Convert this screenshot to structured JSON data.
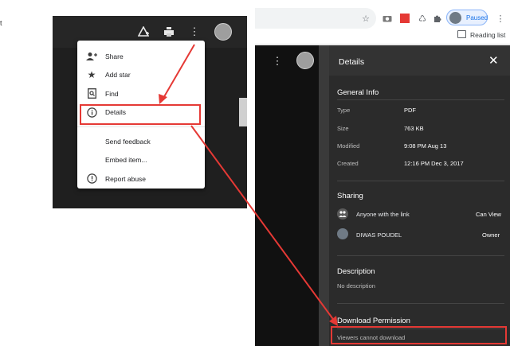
{
  "left_fragment": "t",
  "menu": {
    "items": [
      {
        "label": "Share",
        "icon": "add-person-icon"
      },
      {
        "label": "Add star",
        "icon": "star-icon"
      },
      {
        "label": "Find",
        "icon": "find-in-page-icon"
      },
      {
        "label": "Details",
        "icon": "info-icon"
      },
      {
        "label": "Send feedback",
        "icon": ""
      },
      {
        "label": "Embed item...",
        "icon": ""
      },
      {
        "label": "Report abuse",
        "icon": "report-icon"
      }
    ]
  },
  "browser": {
    "paused_label": "Paused",
    "reading_list_label": "Reading list"
  },
  "details": {
    "title": "Details",
    "general_info_title": "General Info",
    "info": [
      {
        "key": "Type",
        "value": "PDF"
      },
      {
        "key": "Size",
        "value": "763 KB"
      },
      {
        "key": "Modified",
        "value": "9:08 PM Aug 13"
      },
      {
        "key": "Created",
        "value": "12:16 PM Dec 3, 2017"
      }
    ],
    "sharing_title": "Sharing",
    "sharing": [
      {
        "name": "Anyone with the link",
        "role": "Can View"
      },
      {
        "name": "DIWAS POUDEL",
        "role": "Owner"
      }
    ],
    "description_title": "Description",
    "description_text": "No description",
    "download_title": "Download Permission",
    "download_text": "Viewers cannot download"
  },
  "colors": {
    "annotation": "#e53935",
    "panel_bg": "#2b2b2b",
    "menu_bg": "#ffffff"
  }
}
